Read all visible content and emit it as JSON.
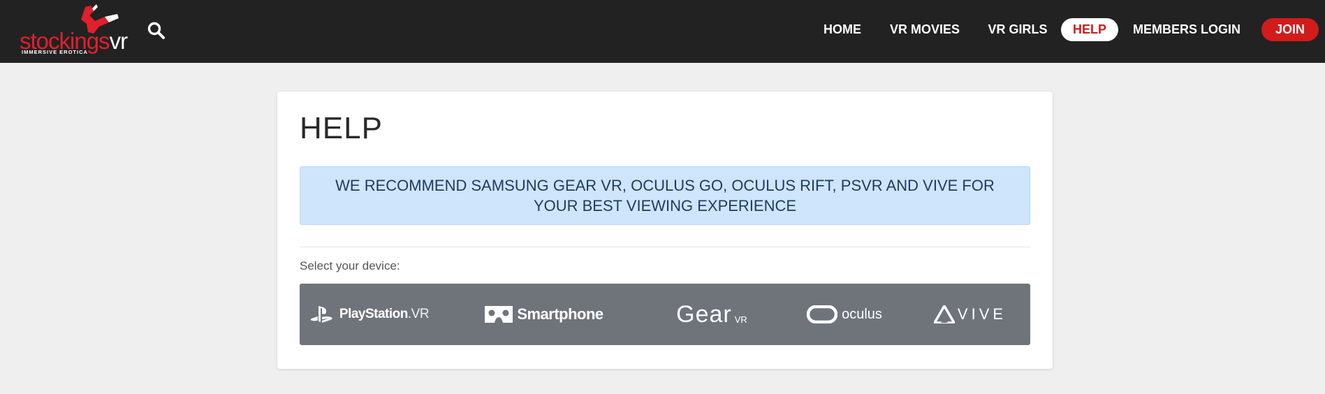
{
  "brand": {
    "logo_red": "stockings",
    "logo_white": "vr",
    "tagline": "IMMERSIVE EROTICA"
  },
  "header": {
    "search_icon": "search-icon",
    "nav": [
      {
        "label": "HOME"
      },
      {
        "label": "VR MOVIES"
      },
      {
        "label": "VR GIRLS"
      },
      {
        "label": "HELP",
        "active": true
      },
      {
        "label": "MEMBERS LOGIN"
      },
      {
        "label": "JOIN"
      }
    ]
  },
  "main": {
    "title": "HELP",
    "recommendation_line1": "WE RECOMMEND SAMSUNG GEAR VR, OCULUS GO, OCULUS RIFT, PSVR AND VIVE FOR",
    "recommendation_line2": "YOUR BEST VIEWING EXPERIENCE",
    "select_label": "Select your device:",
    "devices": [
      {
        "brand": "PlayStation",
        "suffix": ".VR",
        "icon": "playstation-icon"
      },
      {
        "brand": "Smartphone",
        "icon": "cardboard-icon"
      },
      {
        "brand": "Gear",
        "suffix": "VR"
      },
      {
        "brand": "oculus",
        "icon": "oculus-icon"
      },
      {
        "brand": "VIVE",
        "icon": "vive-icon"
      }
    ]
  },
  "colors": {
    "header_bg": "#222222",
    "accent_red": "#d21b1b",
    "alert_bg": "#cfe5fb",
    "alert_text": "#1e3b63",
    "device_bar": "#6f747b",
    "page_bg": "#efefef"
  }
}
